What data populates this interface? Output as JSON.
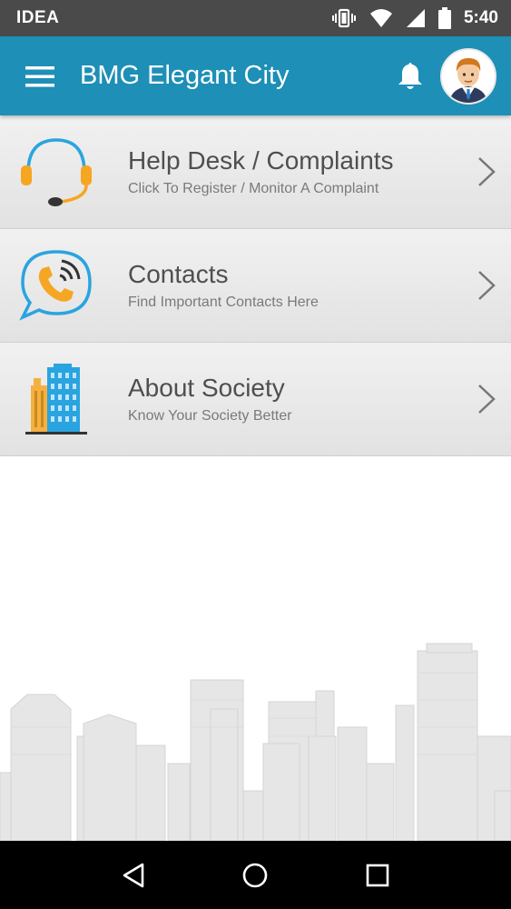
{
  "status_bar": {
    "carrier": "IDEA",
    "time": "5:40",
    "icons": [
      "vibrate-icon",
      "wifi-icon",
      "signal-icon",
      "battery-icon"
    ]
  },
  "app_bar": {
    "title": "BMG Elegant City",
    "menu_icon": "hamburger-menu-icon",
    "notification_icon": "bell-icon",
    "avatar": "user-avatar"
  },
  "menu": {
    "items": [
      {
        "title": "Help Desk / Complaints",
        "subtitle": "Click To Register / Monitor A Complaint",
        "icon": "headset-icon"
      },
      {
        "title": "Contacts",
        "subtitle": "Find Important Contacts Here",
        "icon": "phone-chat-icon"
      },
      {
        "title": "About Society",
        "subtitle": "Know Your Society Better",
        "icon": "buildings-icon"
      }
    ]
  },
  "nav_bar": {
    "buttons": [
      "back-icon",
      "home-icon",
      "recents-icon"
    ]
  },
  "colors": {
    "app_bar": "#1e8fb6",
    "status_bar": "#4a4a4a",
    "row_bg": "#e8e8e8",
    "accent_orange": "#f5a623",
    "accent_blue": "#2aa4e0"
  }
}
